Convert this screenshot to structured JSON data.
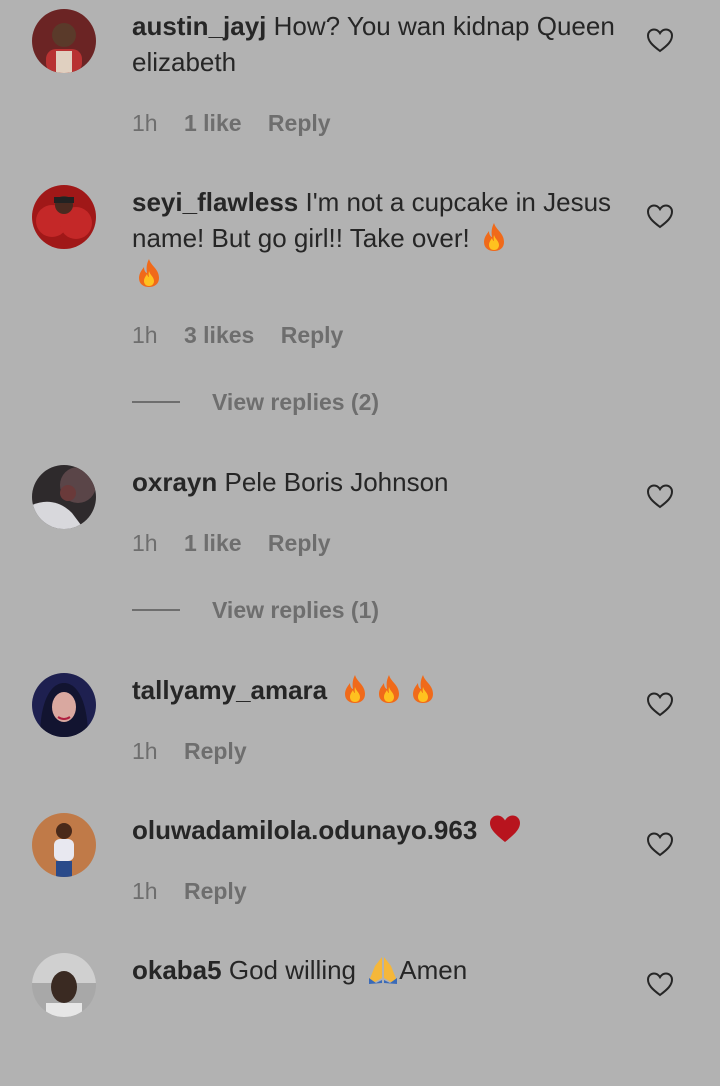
{
  "comments": [
    {
      "username": "austin_jayj",
      "text": "How? You wan kidnap Queen elizabeth",
      "time": "1h",
      "likes": "1 like",
      "reply_label": "Reply",
      "avatar_color": "#7a2626"
    },
    {
      "username": "seyi_flawless",
      "text": "I'm not a cupcake in Jesus name! But go girl!! Take over!",
      "time": "1h",
      "likes": "3 likes",
      "reply_label": "Reply",
      "view_replies": "View replies (2)",
      "avatar_color": "#9a1a1a"
    },
    {
      "username": "oxrayn",
      "text": "Pele Boris Johnson",
      "time": "1h",
      "likes": "1 like",
      "reply_label": "Reply",
      "view_replies": "View replies (1)",
      "avatar_color": "#3a3035"
    },
    {
      "username": "tallyamy_amara",
      "text": "",
      "time": "1h",
      "reply_label": "Reply",
      "avatar_color": "#2a2f6a"
    },
    {
      "username": "oluwadamilola.odunayo.963",
      "text": "",
      "time": "1h",
      "reply_label": "Reply",
      "avatar_color": "#b0693a"
    },
    {
      "username": "okaba5",
      "text_before": "God willing",
      "text_after": "Amen",
      "avatar_color": "#8a8a8a"
    }
  ],
  "icons": {
    "like": "heart-outline-icon",
    "fire": "fire-emoji",
    "red_heart": "red-heart-emoji",
    "pray": "folded-hands-emoji"
  },
  "colors": {
    "background": "#b2b2b2",
    "text": "#262626",
    "meta": "#6e6e6e"
  }
}
